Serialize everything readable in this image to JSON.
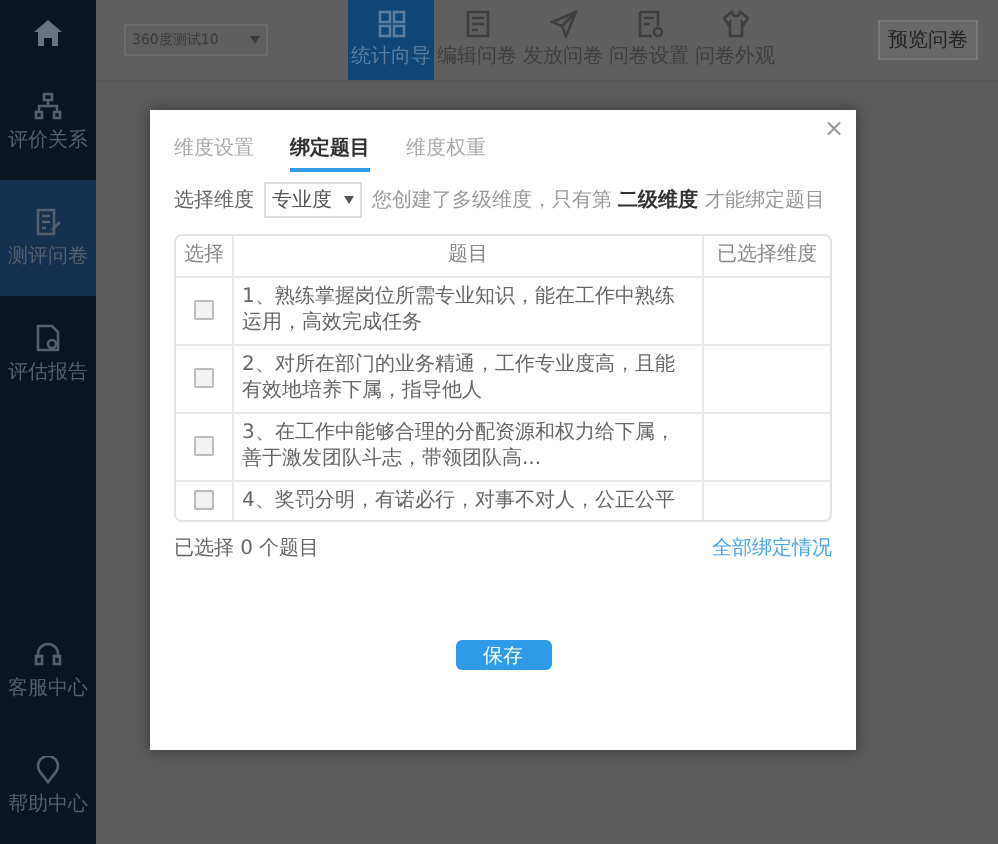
{
  "sidebar": {
    "items": [
      {
        "label": "评价关系",
        "selected": false
      },
      {
        "label": "测评问卷",
        "selected": true
      },
      {
        "label": "评估报告",
        "selected": false
      }
    ],
    "bottom_items": [
      {
        "label": "客服中心"
      },
      {
        "label": "帮助中心"
      }
    ]
  },
  "topbar": {
    "survey_select": "360度测试10",
    "tools": [
      {
        "label": "统计向导",
        "selected": true
      },
      {
        "label": "编辑问卷",
        "selected": false
      },
      {
        "label": "发放问卷",
        "selected": false
      },
      {
        "label": "问卷设置",
        "selected": false
      },
      {
        "label": "问卷外观",
        "selected": false
      }
    ],
    "preview_button": "预览问卷"
  },
  "dialog": {
    "close": "×",
    "tabs": [
      {
        "label": "维度设置",
        "selected": false
      },
      {
        "label": "绑定题目",
        "selected": true
      },
      {
        "label": "维度权重",
        "selected": false
      }
    ],
    "filter": {
      "label": "选择维度",
      "value": "专业度",
      "hint": "您创建了多级维度，只有第 **二级维度** 才能绑定题目"
    },
    "table": {
      "columns": [
        "选择",
        "题目",
        "已选择维度"
      ],
      "rows": [
        {
          "checked": false,
          "question": "1、熟练掌握岗位所需专业知识，能在工作中熟练运用，高效完成任务"
        },
        {
          "checked": false,
          "question": "2、对所在部门的业务精通，工作专业度高，且能有效地培养下属，指导他人"
        },
        {
          "checked": false,
          "question": "3、在工作中能够合理的分配资源和权力给下属，善于激发团队斗志，带领团队高..."
        },
        {
          "checked": false,
          "question": "4、奖罚分明，有诺必行，对事不对人，公正公平"
        }
      ]
    },
    "selected_count": "已选择 0 个题目",
    "binding_link": "全部绑定情况",
    "save_button": "保存"
  }
}
